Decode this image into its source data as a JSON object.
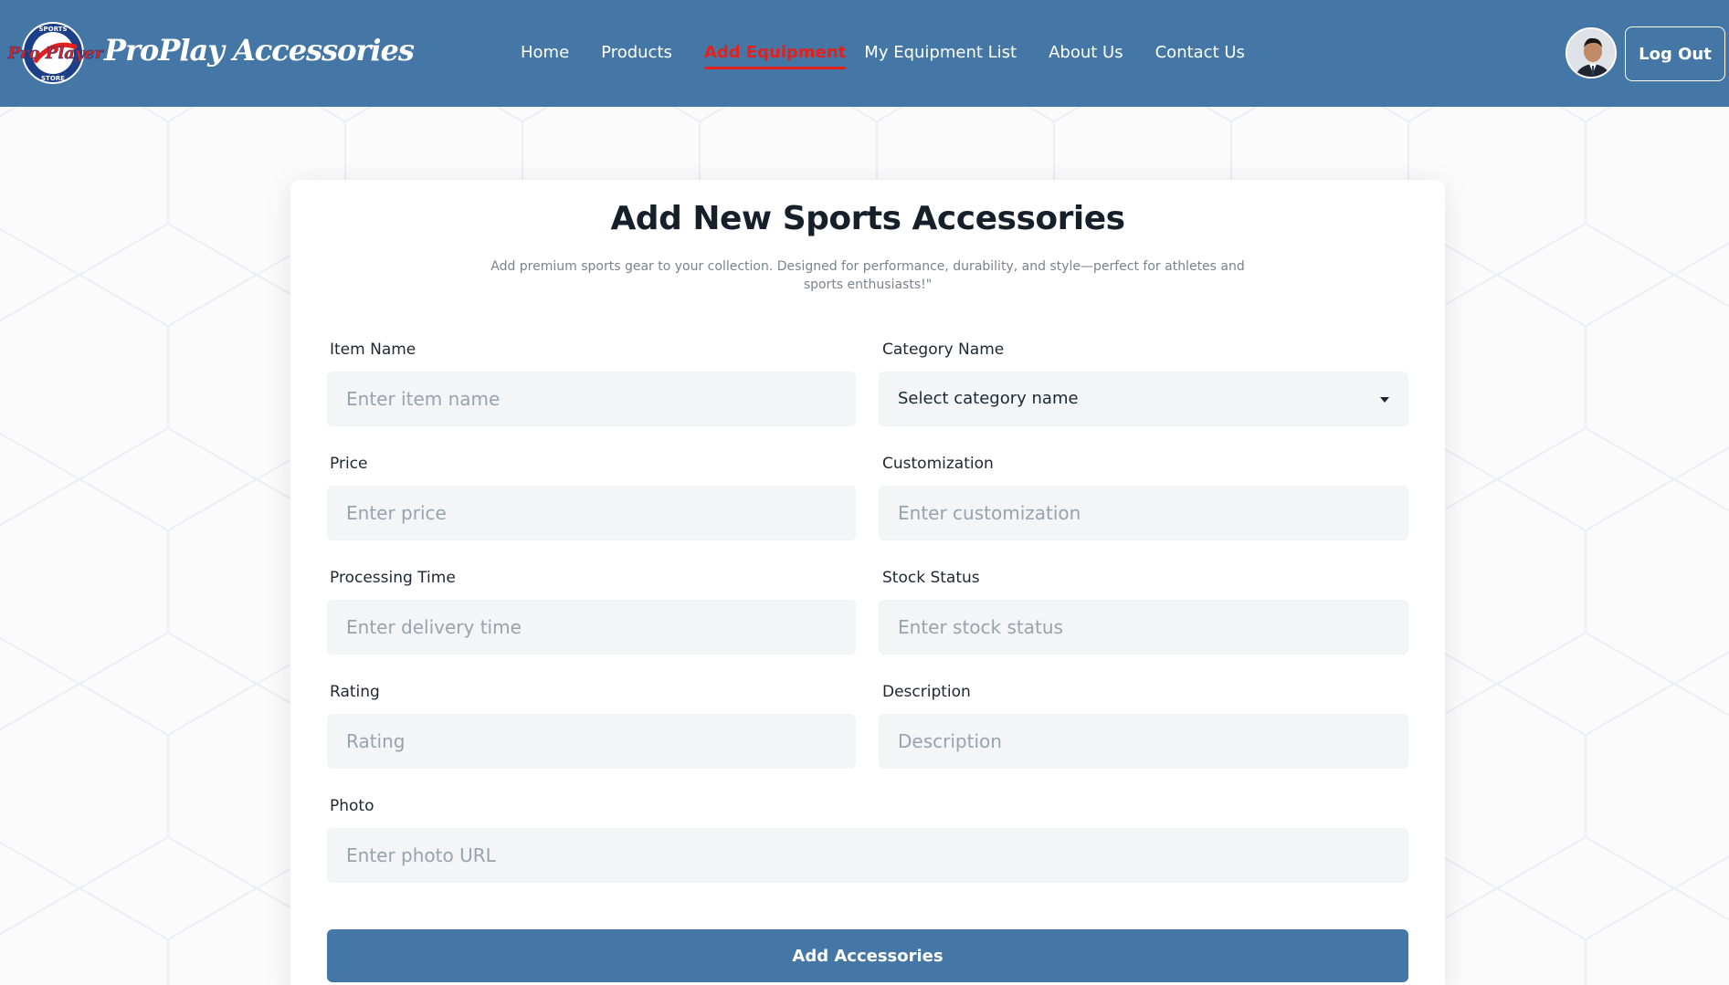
{
  "brand": {
    "name": "ProPlay Accessories",
    "logo_text": "Pro Player",
    "logo_ring_top": "SPORTS",
    "logo_ring_bottom": "STORE"
  },
  "nav": {
    "items": [
      {
        "label": "Home",
        "active": false
      },
      {
        "label": "Products",
        "active": false
      },
      {
        "label": "Add Equipment",
        "active": true
      },
      {
        "label": "My Equipment List",
        "active": false
      },
      {
        "label": "About Us",
        "active": false
      },
      {
        "label": "Contact Us",
        "active": false
      }
    ],
    "logout_label": "Log Out"
  },
  "form": {
    "title": "Add New Sports Accessories",
    "subtitle": "Add premium sports gear to your collection. Designed for performance, durability, and style—perfect for athletes and sports enthusiasts!\"",
    "fields": {
      "item_name": {
        "label": "Item Name",
        "placeholder": "Enter item name",
        "value": ""
      },
      "category": {
        "label": "Category Name",
        "selected": "Select category name"
      },
      "price": {
        "label": "Price",
        "placeholder": "Enter price",
        "value": ""
      },
      "customization": {
        "label": "Customization",
        "placeholder": "Enter customization",
        "value": ""
      },
      "processing_time": {
        "label": "Processing Time",
        "placeholder": "Enter delivery time",
        "value": ""
      },
      "stock_status": {
        "label": "Stock Status",
        "placeholder": "Enter stock status",
        "value": ""
      },
      "rating": {
        "label": "Rating",
        "placeholder": "Rating",
        "value": ""
      },
      "description": {
        "label": "Description",
        "placeholder": "Description",
        "value": ""
      },
      "photo": {
        "label": "Photo",
        "placeholder": "Enter photo URL",
        "value": ""
      }
    },
    "submit_label": "Add Accessories"
  },
  "colors": {
    "navbar": "#4577a6",
    "active_nav": "#e3201b",
    "button": "#4577a6",
    "input_bg": "#f3f5f7"
  }
}
